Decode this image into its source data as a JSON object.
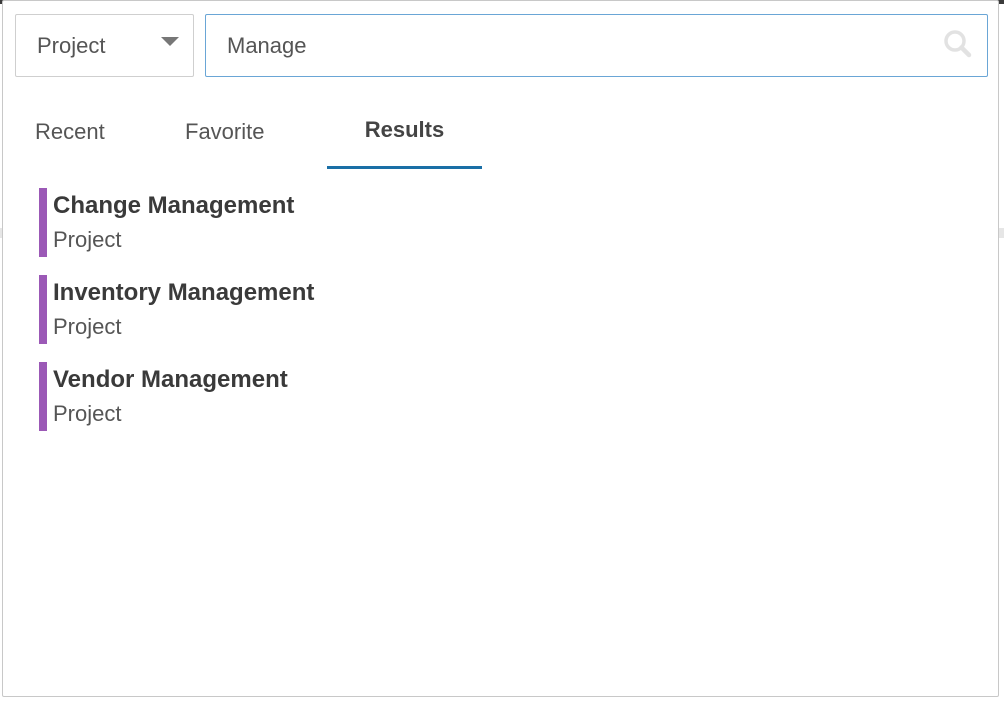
{
  "scope_select": {
    "value": "Project",
    "icon": "caret-down-icon"
  },
  "search": {
    "value": "Manage",
    "icon": "search-icon"
  },
  "tabs": [
    {
      "label": "Recent",
      "active": false
    },
    {
      "label": "Favorite",
      "active": false
    },
    {
      "label": "Results",
      "active": true
    }
  ],
  "results": [
    {
      "title": "Change Management",
      "type": "Project"
    },
    {
      "title": "Inventory Management",
      "type": "Project"
    },
    {
      "title": "Vendor Management",
      "type": "Project"
    }
  ],
  "colors": {
    "accent_bar": "#9b59b6",
    "active_tab_underline": "#1a6fa6",
    "search_border": "#6aa6d6"
  }
}
